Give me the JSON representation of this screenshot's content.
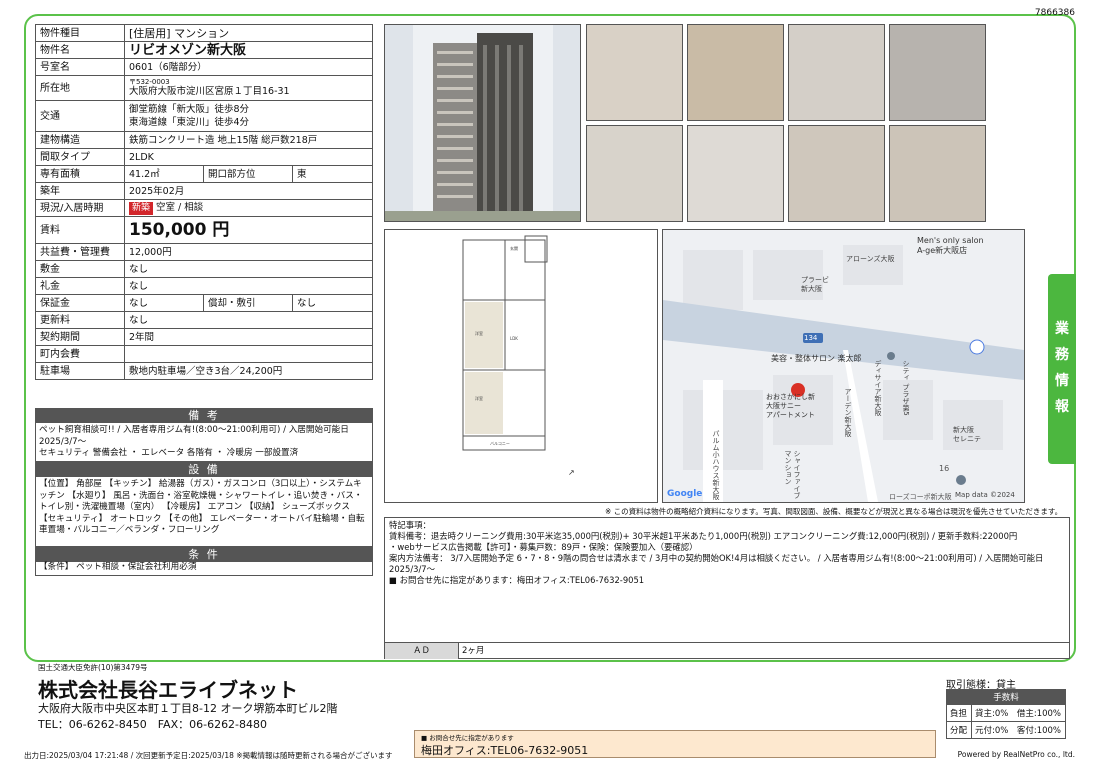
{
  "doc_id": "7866386",
  "spec": {
    "rows": [
      {
        "label": "物件種目",
        "value": "[住居用] マンション"
      },
      {
        "label": "物件名",
        "value": "リビオメゾン新大阪"
      },
      {
        "label": "号室名",
        "value": "0601（6階部分）"
      },
      {
        "label": "所在地",
        "value_line1": "〒532-0003",
        "value_line2": "大阪府大阪市淀川区宮原１丁目16-31"
      },
      {
        "label": "交通",
        "value_line1": "御堂筋線「新大阪」徒歩8分",
        "value_line2": "東海道線「東淀川」徒歩4分"
      },
      {
        "label": "建物構造",
        "value": "鉄筋コンクリート造 地上15階 総戸数218戸"
      },
      {
        "label": "間取タイプ",
        "value": "2LDK"
      },
      {
        "label": "専有面積",
        "value": "41.2㎡",
        "label2": "開口部方位",
        "value2": "東"
      },
      {
        "label": "築年",
        "value": "2025年02月"
      },
      {
        "label": "現況/入居時期",
        "badge": "新築",
        "value": "空室 / 相談"
      },
      {
        "label": "賃料",
        "value": "150,000 円"
      },
      {
        "label": "共益費・管理費",
        "value": "12,000円"
      },
      {
        "label": "敷金",
        "value": "なし"
      },
      {
        "label": "礼金",
        "value": "なし"
      },
      {
        "label": "保証金",
        "value": "なし",
        "label2": "償却・敷引",
        "value2": "なし"
      },
      {
        "label": "更新料",
        "value": "なし"
      },
      {
        "label": "契約期間",
        "value": "2年間"
      },
      {
        "label": "町内会費",
        "value": ""
      },
      {
        "label": "駐車場",
        "value": "敷地内駐車場／空き3台／24,200円"
      }
    ]
  },
  "remarks": {
    "title": "備 考",
    "text": "ペット飼育相談可!! / 入居者専用ジム有!(8:00～21:00利用可) / 入居開始可能日2025/3/7～\nセキュリティ 警備会社 ・ エレベータ 各階有 ・ 冷暖房 一部設置済"
  },
  "equipment": {
    "title": "設 備",
    "text": "【位置】 角部屋 【キッチン】 給湯器（ガス）・ガスコンロ（3口以上）・システムキッチン 【水廻り】 風呂・洗面台・浴室乾燥機・シャワートイレ・追い焚き・バス・トイレ別・洗濯機置場（室内） 【冷暖房】 エアコン 【収納】 シューズボックス 【セキュリティ】 オートロック 【その他】 エレベーター・オートバイ駐輪場・自転車置場・バルコニー／ベランダ・フローリング"
  },
  "conditions": {
    "title": "条 件",
    "text": "【条件】 ペット相談・保証会社利用必須"
  },
  "disclaimer": "※ この資料は物件の概略紹介資料になります。写真、間取図面、設備、概要などが現況と異なる場合は現況を優先させていただきます。",
  "map": {
    "labels": [
      "Men's only salon",
      "A-ge新大阪店",
      "アローンズ大阪",
      "プラービ",
      "新大阪",
      "134",
      "美容・整体サロン 楽太郎",
      "おおさかにし新",
      "大阪サニー",
      "アパートメント",
      "アーデン新大阪",
      "ディサイア新大阪",
      "シティ",
      "プラザ第5",
      "新大阪",
      "セレニテ",
      "パルム小ハウス新大阪",
      "シャイファイブ",
      "マンション",
      "16",
      "ローズコーポ新大阪",
      "Google",
      "Map data ©2024"
    ]
  },
  "special_notes": {
    "title": "特記事項：",
    "lines": [
      "賃料備考：退去時クリーニング費用:30平米迄35,000円(税別)+ 30平米超1平米あたり1,000円(税別) エアコンクリーニング費:12,000円(税別) / 更新手数料:22000円",
      "・webサービス広告掲載【許可】・募集戸数：89戸・保険：保険要加入（要確認）",
      "案内方法備考： 3/7入居開始予定 6・7・8・9階の問合せは清水まで / 3月中の契約開始OK!4月は相談ください。 / 入居者専用ジム有!(8:00～21:00利用可) / 入居開始可能日2025/3/7～",
      "■ お問合せ先に指定があります：梅田オフィス:TEL06-7632-9051"
    ],
    "ad_label": "ＡＤ",
    "ad_value": "2ヶ月"
  },
  "company": {
    "license": "国土交通大臣免許(10)第3479号",
    "name": "株式会社長谷エライブネット",
    "address": "大阪府大阪市中央区本町１丁目8-12 オーク堺筋本町ビル2階",
    "tel_fax": "TEL：06-6262-8450　FAX：06-6262-8480"
  },
  "transaction": {
    "label": "取引態様：貸主",
    "fee_title": "手数料",
    "rows": [
      {
        "label": "負担",
        "value": "貸主:0%　借主:100%"
      },
      {
        "label": "分配",
        "value": "元付:0%　客付:100%"
      }
    ]
  },
  "side_tab": "業務情報",
  "footer": {
    "left": "出力日:2025/03/04 17:21:48 / 次回更新予定日:2025/03/18 ※掲載情報は随時更新される場合がございます",
    "right": "Powered by RealNetPro co., ltd."
  },
  "contact_box": {
    "small": "■ お問合せ先に指定があります",
    "main": "梅田オフィス:TEL06-7632-9051"
  }
}
